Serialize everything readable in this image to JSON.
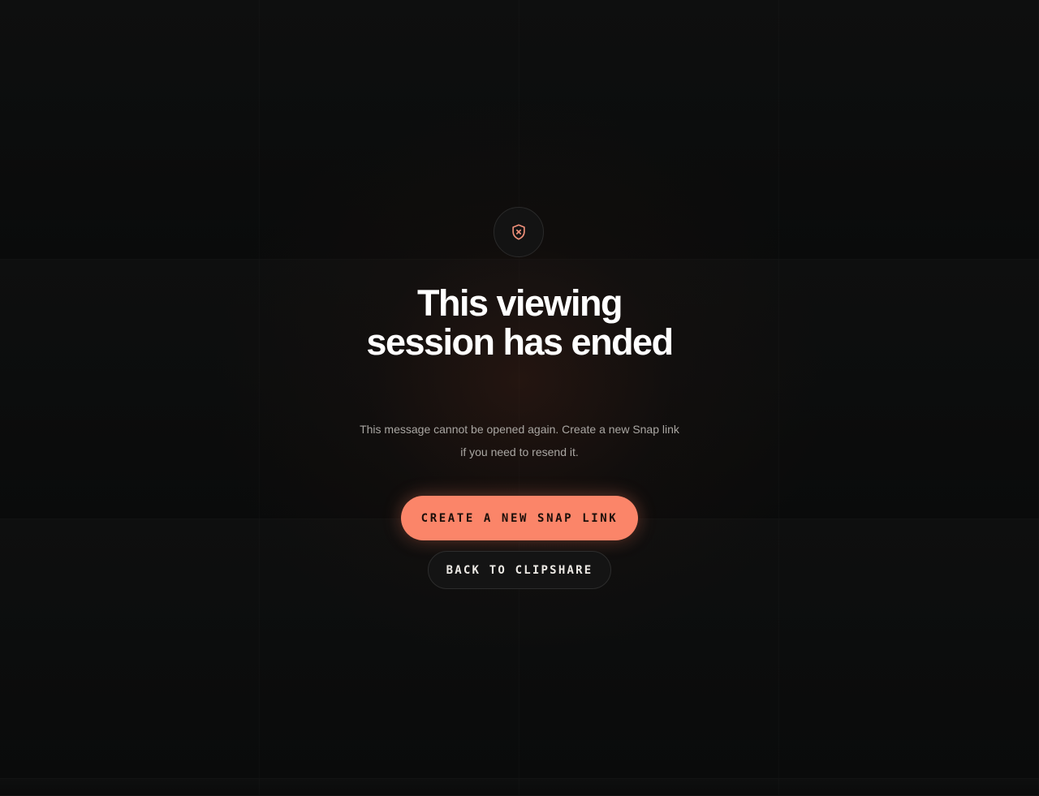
{
  "status_icon": {
    "name": "shield-x-icon",
    "color": "#f0907a"
  },
  "title": "This viewing session has ended",
  "subtitle": "This message cannot be opened again. Create a new Snap link if you need to resend it.",
  "actions": {
    "primary_label": "CREATE A NEW SNAP LINK",
    "secondary_label": "BACK TO CLIPSHARE"
  },
  "colors": {
    "background": "#0b0c0c",
    "accent": "#fb8569",
    "title_text": "#ffffff",
    "subtitle_text": "#a9a6a2"
  }
}
